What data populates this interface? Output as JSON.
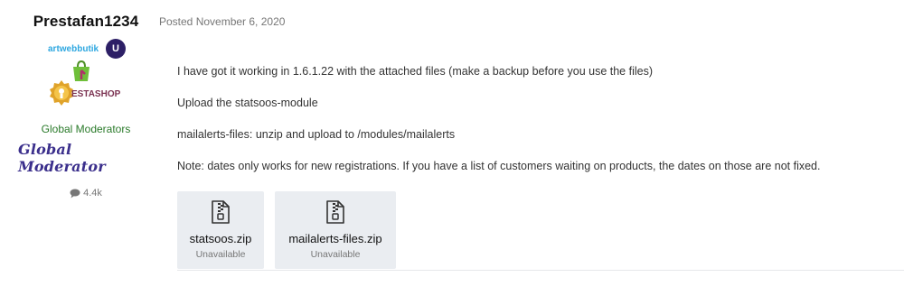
{
  "author": {
    "name": "Prestafan1234",
    "avatar_brand_text": "artwebbutik",
    "avatar_badge_text": "U",
    "avatar_shop_text": "ESTASHOP",
    "group": "Global Moderators",
    "rank": "Global Moderator",
    "post_count": "4.4k",
    "colors": {
      "group": "#2a7a2a",
      "rank": "#3b2f8c"
    }
  },
  "post": {
    "date": "Posted November 6, 2020",
    "paragraphs": [
      "I have got it working in 1.6.1.22 with the attached files (make a backup before you use the files)",
      "Upload the statsoos-module",
      "mailalerts-files: unzip and upload to /modules/mailalerts",
      "Note: dates only works for new registrations. If you have a list of customers waiting on products, the dates on those are not fixed."
    ],
    "attachments": [
      {
        "name": "statsoos.zip",
        "status": "Unavailable",
        "icon": "zip-file-icon"
      },
      {
        "name": "mailalerts-files.zip",
        "status": "Unavailable",
        "icon": "zip-file-icon"
      }
    ]
  }
}
